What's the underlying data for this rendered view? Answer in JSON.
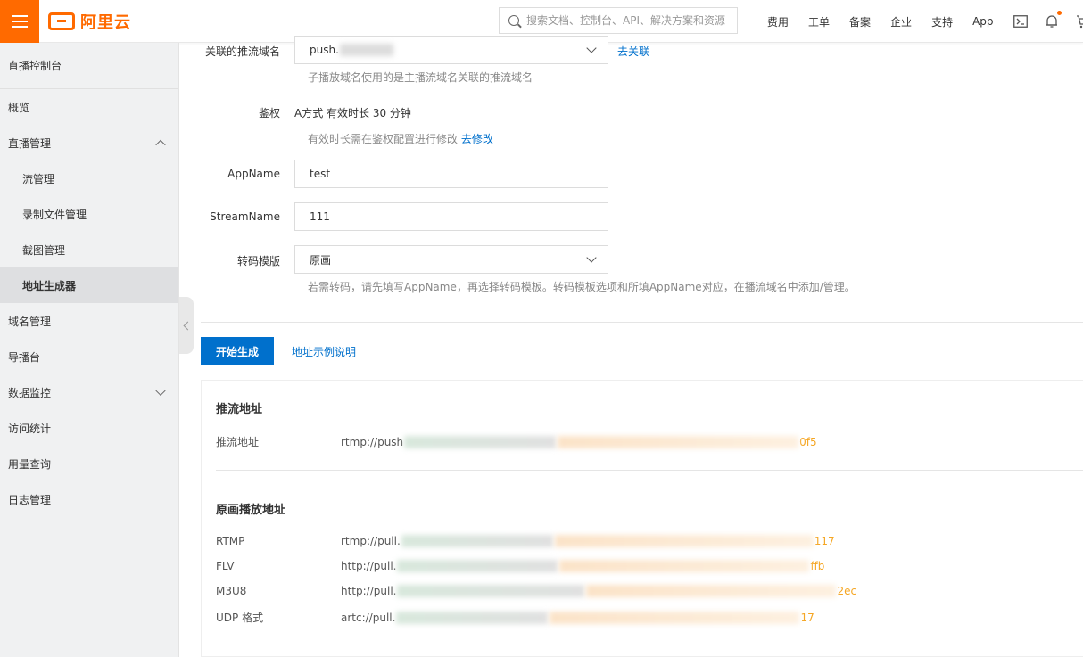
{
  "header": {
    "brand": "阿里云",
    "search_placeholder": "搜索文档、控制台、API、解决方案和资源",
    "nav": [
      "费用",
      "工单",
      "备案",
      "企业",
      "支持",
      "App"
    ]
  },
  "sidebar": {
    "title": "直播控制台",
    "items": [
      {
        "label": "概览"
      },
      {
        "label": "直播管理"
      },
      {
        "label": "流管理"
      },
      {
        "label": "录制文件管理"
      },
      {
        "label": "截图管理"
      },
      {
        "label": "地址生成器"
      },
      {
        "label": "域名管理"
      },
      {
        "label": "导播台"
      },
      {
        "label": "数据监控"
      },
      {
        "label": "访问统计"
      },
      {
        "label": "用量查询"
      },
      {
        "label": "日志管理"
      }
    ]
  },
  "form": {
    "push_domain": {
      "label": "关联的推流域名",
      "value": "push.",
      "link": "去关联",
      "help": "子播放域名使用的是主播流域名关联的推流域名"
    },
    "auth": {
      "label": "鉴权",
      "value": "A方式 有效时长 30 分钟",
      "help": "有效时长需在鉴权配置进行修改",
      "link": "去修改"
    },
    "appname": {
      "label": "AppName",
      "value": "test"
    },
    "streamname": {
      "label": "StreamName",
      "value": "111"
    },
    "template": {
      "label": "转码模版",
      "value": "原画",
      "help": "若需转码，请先填写AppName，再选择转码模板。转码模板选项和所填AppName对应，在播流域名中添加/管理。"
    }
  },
  "actions": {
    "generate": "开始生成",
    "example": "地址示例说明"
  },
  "results": {
    "push_section": "推流地址",
    "push": {
      "label": "推流地址",
      "prefix": "rtmp://push",
      "tail": "0f5"
    },
    "play_section": "原画播放地址",
    "play": [
      {
        "label": "RTMP",
        "prefix": "rtmp://pull.",
        "tail": "117"
      },
      {
        "label": "FLV",
        "prefix": "http://pull.",
        "tail": "ffb"
      },
      {
        "label": "M3U8",
        "prefix": "http://pull.",
        "tail": "2ec"
      },
      {
        "label": "UDP 格式",
        "prefix": "artc://pull.",
        "tail": "17"
      }
    ]
  },
  "colors": {
    "brand": "#ff6a00",
    "primary": "#0070cc",
    "blurred_tail": "#f5a623"
  }
}
